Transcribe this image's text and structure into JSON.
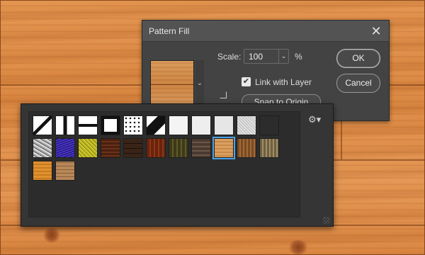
{
  "dialog": {
    "title": "Pattern Fill",
    "scale_label": "Scale:",
    "scale_value": "100",
    "scale_unit": "%",
    "link_label": "Link with Layer",
    "link_checked": true,
    "snap_label": "Snap to Origin",
    "ok_label": "OK",
    "cancel_label": "Cancel"
  },
  "picker": {
    "selected_index": 19,
    "swatches": [
      {
        "kind": "diag-line",
        "color": "#ffffff"
      },
      {
        "kind": "vert-bar",
        "color": "#ffffff"
      },
      {
        "kind": "horiz-bar",
        "color": "#ffffff"
      },
      {
        "kind": "frame",
        "color": "#ffffff"
      },
      {
        "kind": "dots",
        "color": "#ffffff"
      },
      {
        "kind": "diag-thick",
        "color": "#ffffff"
      },
      {
        "kind": "white",
        "color": "#f4f4f4"
      },
      {
        "kind": "white2",
        "color": "#eeeeee"
      },
      {
        "kind": "white3",
        "color": "#e6e6e6"
      },
      {
        "kind": "noise",
        "color": "#cfcfcf"
      },
      {
        "kind": "concentric",
        "color": "#ffffff"
      },
      {
        "kind": "granite",
        "color": "#9a9a9a"
      },
      {
        "kind": "purple",
        "color": "#3a2aa8"
      },
      {
        "kind": "yellow",
        "color": "#c8c22a"
      },
      {
        "kind": "wood-dark",
        "color": "#5a2a14"
      },
      {
        "kind": "wood-planks",
        "color": "#4a3020"
      },
      {
        "kind": "wood-red",
        "color": "#7a2e12"
      },
      {
        "kind": "wood-olive",
        "color": "#4e4a22"
      },
      {
        "kind": "wood-gray",
        "color": "#5a4838"
      },
      {
        "kind": "wood-light",
        "color": "#d59a5a"
      },
      {
        "kind": "wood-brown",
        "color": "#8a5a30"
      },
      {
        "kind": "wood-tan",
        "color": "#8a7a5a"
      },
      {
        "kind": "wood-orange",
        "color": "#d88a34"
      },
      {
        "kind": "parquet",
        "color": "#a8784a"
      }
    ]
  }
}
